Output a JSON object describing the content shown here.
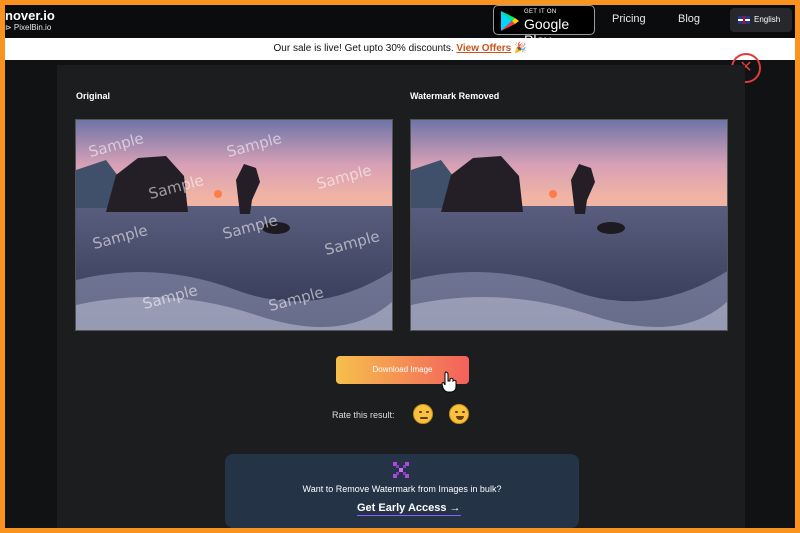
{
  "header": {
    "logo_main": "nover.io",
    "logo_sub": "⊳ PixelBin.io",
    "google_play_small": "GET IT ON",
    "google_play_big": "Google Play",
    "nav": [
      "Pricing",
      "Blog"
    ],
    "language": "English"
  },
  "banner": {
    "text": "Our sale is live! Get upto 30% discounts. ",
    "offer_label": "View Offers",
    "offer_icon": "🎉"
  },
  "modal": {
    "close_label": "✕",
    "original_label": "Original",
    "result_label": "Watermark Removed",
    "watermark_text": "Sample",
    "download_label": "Download Image",
    "rate_label": "Rate this result:",
    "bulk": {
      "text": "Want to Remove Watermark from Images in bulk?",
      "link_label": "Get Early Access",
      "arrow": "→"
    }
  },
  "colors": {
    "frame_border": "#f7931e",
    "close_accent": "#e23b3b",
    "offer_link": "#c9541b",
    "bulk_bg": "#243346"
  }
}
